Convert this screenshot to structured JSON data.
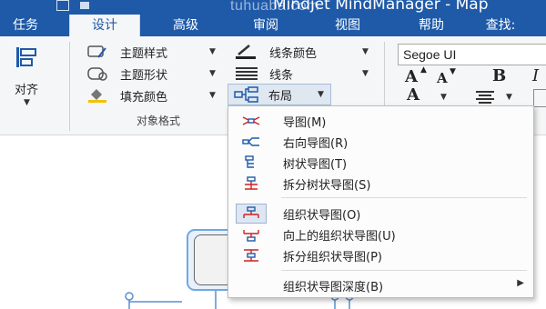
{
  "titlebar": {
    "app_title": "Mindjet MindManager - Map",
    "watermark": "tuhuaba.com"
  },
  "tabs": [
    {
      "label": "任务",
      "active": false
    },
    {
      "label": "设计",
      "active": true
    },
    {
      "label": "高级",
      "active": false
    },
    {
      "label": "审阅",
      "active": false
    },
    {
      "label": "视图",
      "active": false
    },
    {
      "label": "帮助",
      "active": false
    },
    {
      "label": "查找:",
      "active": false
    }
  ],
  "ribbon": {
    "align": {
      "label": "对齐",
      "icon": "align-icon"
    },
    "topic_style": {
      "label": "主题样式",
      "icon": "topic-style-icon"
    },
    "topic_shape": {
      "label": "主题形状",
      "icon": "topic-shape-icon"
    },
    "fill_color": {
      "label": "填充颜色",
      "icon": "fill-color-icon"
    },
    "line_color": {
      "label": "线条颜色",
      "icon": "line-color-icon"
    },
    "line": {
      "label": "线条",
      "icon": "line-icon"
    },
    "layout": {
      "label": "布局",
      "icon": "layout-icon"
    },
    "group_label": "对象格式",
    "font": {
      "name": "Segoe UI"
    },
    "grow_font": "A",
    "shrink_font": "A",
    "bold": "B",
    "italic": "I",
    "font_color": "A",
    "accent_color": "#1f5aa8"
  },
  "layout_menu": {
    "items": [
      {
        "label": "导图(M)",
        "icon": "map-layout-icon",
        "checked": false
      },
      {
        "label": "右向导图(R)",
        "icon": "right-map-layout-icon",
        "checked": false
      },
      {
        "label": "树状导图(T)",
        "icon": "tree-layout-icon",
        "checked": false
      },
      {
        "label": "拆分树状导图(S)",
        "icon": "split-tree-layout-icon",
        "checked": false
      },
      {
        "label": "组织状导图(O)",
        "icon": "org-chart-layout-icon",
        "checked": true
      },
      {
        "label": "向上的组织状导图(U)",
        "icon": "up-org-chart-layout-icon",
        "checked": false
      },
      {
        "label": "拆分组织状导图(P)",
        "icon": "split-org-chart-layout-icon",
        "checked": false
      },
      {
        "label": "组织状导图深度(B)",
        "icon": "",
        "checked": false,
        "has_submenu": true
      }
    ]
  }
}
